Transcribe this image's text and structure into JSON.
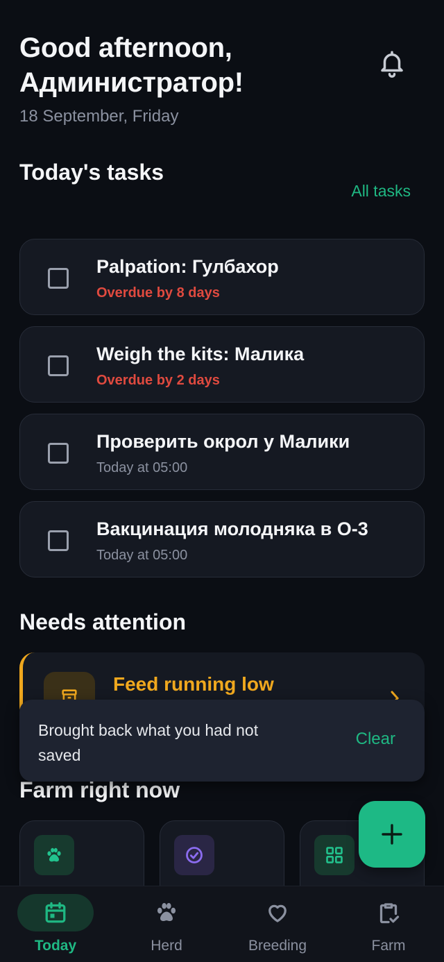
{
  "header": {
    "greeting_line1": "Good afternoon,",
    "greeting_line2": "Администратор!",
    "date": "18 September, Friday",
    "notification_icon": "bell-icon"
  },
  "tasks_section": {
    "title": "Today's tasks",
    "all_tasks_label": "All tasks",
    "items": [
      {
        "title": "Palpation: Гулбахор",
        "meta": "Overdue by 8 days",
        "status": "overdue"
      },
      {
        "title": "Weigh the kits: Малика",
        "meta": "Overdue by 2 days",
        "status": "overdue"
      },
      {
        "title": "Проверить окрол у Малики",
        "meta": "Today at 05:00",
        "status": "scheduled"
      },
      {
        "title": "Вакцинация молодняка в О-3",
        "meta": "Today at 05:00",
        "status": "scheduled"
      }
    ]
  },
  "attention_section": {
    "title": "Needs attention",
    "alert": {
      "title": "Feed running low",
      "icon": "feed-icon"
    }
  },
  "snackbar": {
    "message": "Brought back what you had not saved",
    "action": "Clear"
  },
  "farm_section": {
    "title": "Farm right now",
    "cards": [
      {
        "icon": "paw-icon"
      },
      {
        "icon": "check-circle-icon"
      },
      {
        "icon": "grid-icon"
      }
    ]
  },
  "fab": {
    "icon": "plus-icon"
  },
  "bottom_nav": {
    "items": [
      {
        "label": "Today",
        "icon": "calendar-icon",
        "active": true
      },
      {
        "label": "Herd",
        "icon": "paw-icon",
        "active": false
      },
      {
        "label": "Breeding",
        "icon": "heart-icon",
        "active": false
      },
      {
        "label": "Farm",
        "icon": "clipboard-check-icon",
        "active": false
      }
    ]
  },
  "colors": {
    "background": "#0b0e14",
    "card": "#151922",
    "accent": "#1fb883",
    "overdue": "#e04a3f",
    "warning": "#f0a81e"
  }
}
